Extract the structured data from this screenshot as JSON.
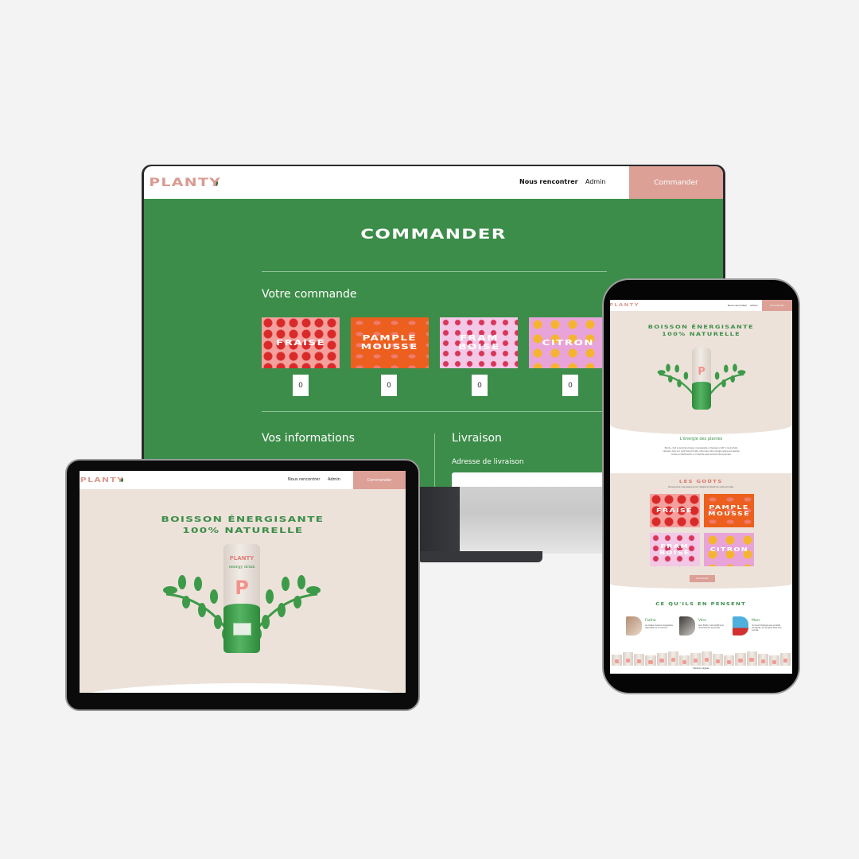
{
  "brand": {
    "logo": "PLANTY",
    "colors": {
      "pink": "#dca097",
      "green": "#3c8d49",
      "beige": "#ece2d9",
      "white": "#ffffff"
    }
  },
  "nav": {
    "links": [
      "Nous rencontrer",
      "Admin"
    ],
    "cta": "Commander"
  },
  "desktop": {
    "page_title": "COMMANDER",
    "order_section": {
      "title": "Votre commande",
      "flavours": [
        {
          "label_line1": "FRAISE",
          "label_line2": "",
          "quantity": "0",
          "pattern": "fraise"
        },
        {
          "label_line1": "PAMPLE",
          "label_line2": "MOUSSE",
          "quantity": "0",
          "pattern": "pamplemousse"
        },
        {
          "label_line1": "FRAM",
          "label_line2": "BOISE",
          "quantity": "0",
          "pattern": "framboise"
        },
        {
          "label_line1": "CITRON",
          "label_line2": "",
          "quantity": "0",
          "pattern": "citron"
        }
      ]
    },
    "info_section": {
      "title": "Vos informations"
    },
    "delivery_section": {
      "title": "Livraison",
      "address_label": "Adresse de livraison",
      "address_value": ""
    }
  },
  "tablet": {
    "hero_line1": "BOISSON ÉNERGISANTE",
    "hero_line2": "100% NATURELLE",
    "can": {
      "brand": "PLANTY",
      "subtitle": "energy drink",
      "letter": "P"
    }
  },
  "phone": {
    "hero_line1": "BOISSON ÉNERGISANTE",
    "hero_line2": "100% NATURELLE",
    "energy_title": "L'énergie des plantes",
    "energy_text": "Planty, c'est la première boisson énergisante composée à 100 % de produits naturels. Avec son goût frais et fruité, retrouvez votre énergie grâce aux plantes riches en vitamine B₁₂, à n'importe quel moment de la journée.",
    "gouts_title": "LES GOÛTS",
    "gouts_subtitle": "Nous avons une saveur pour chaque moment de votre journée.",
    "gouts_button": "Commander",
    "flavours": [
      {
        "label_line1": "FRAISE",
        "label_line2": ""
      },
      {
        "label_line1": "PAMPLE",
        "label_line2": "MOUSSE"
      },
      {
        "label_line1": "FRAM",
        "label_line2": "BOISE"
      },
      {
        "label_line1": "CITRON",
        "label_line2": ""
      }
    ],
    "reviews_title": "CE QU'ILS EN PENSENT",
    "reviews": [
      {
        "name": "Fatiha",
        "text": "Le meilleur boisson énergisante disponible sur le marché !"
      },
      {
        "name": "Véro",
        "text": "Avec Planty c'est parfait pour recommencer la journée."
      },
      {
        "name": "Marc",
        "text": "Un boost d'énergie avec produits chimiques, et une glace dans mon journée."
      }
    ],
    "footer": "Mentions légales"
  }
}
